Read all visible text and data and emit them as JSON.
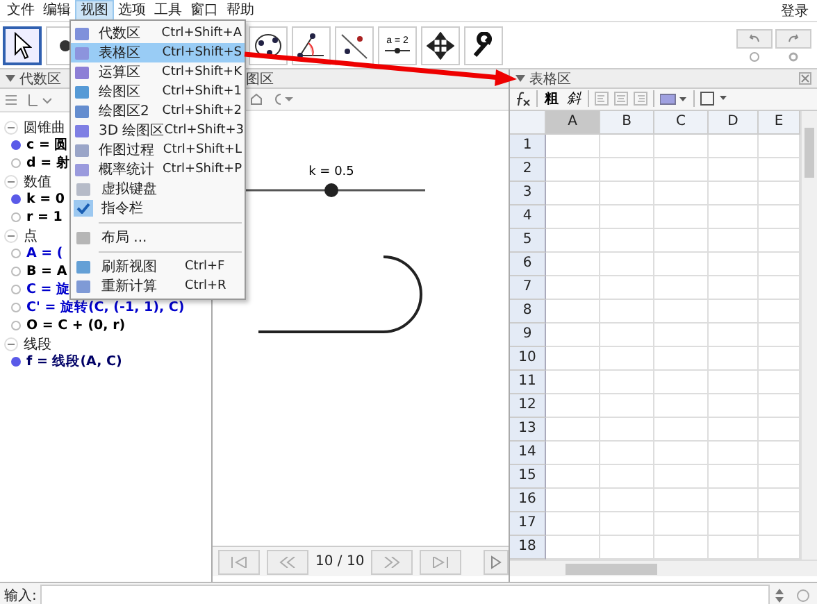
{
  "menu_bar": {
    "items": [
      {
        "label": "文件",
        "selected": false
      },
      {
        "label": "编辑",
        "selected": false
      },
      {
        "label": "视图",
        "selected": true
      },
      {
        "label": "选项",
        "selected": false
      },
      {
        "label": "工具",
        "selected": false
      },
      {
        "label": "窗口",
        "selected": false
      },
      {
        "label": "帮助",
        "selected": false
      }
    ],
    "login": "登录"
  },
  "toolbar": {
    "tools_left": [
      {
        "kind": "select",
        "selected": true
      },
      {
        "kind": "point",
        "selected": false
      }
    ],
    "tools_right": [
      {
        "kind": "circle",
        "selected": false
      },
      {
        "kind": "angle",
        "selected": false
      },
      {
        "kind": "reflect",
        "selected": false
      },
      {
        "kind": "slider",
        "label": "a = 2",
        "selected": false
      },
      {
        "kind": "move",
        "selected": false
      },
      {
        "kind": "wrench",
        "selected": false
      }
    ]
  },
  "view_menu": {
    "items": [
      {
        "kind": "item",
        "label": "代数区",
        "shortcut": "Ctrl+Shift+A",
        "selected": false
      },
      {
        "kind": "item",
        "label": "表格区",
        "shortcut": "Ctrl+Shift+S",
        "selected": true
      },
      {
        "kind": "item",
        "label": "运算区",
        "shortcut": "Ctrl+Shift+K",
        "selected": false
      },
      {
        "kind": "item",
        "label": "绘图区",
        "shortcut": "Ctrl+Shift+1",
        "selected": false
      },
      {
        "kind": "item",
        "label": "绘图区2",
        "shortcut": "Ctrl+Shift+2",
        "selected": false
      },
      {
        "kind": "item",
        "label": "3D 绘图区",
        "shortcut": "Ctrl+Shift+3",
        "selected": false
      },
      {
        "kind": "item",
        "label": "作图过程",
        "shortcut": "Ctrl+Shift+L",
        "selected": false
      },
      {
        "kind": "item",
        "label": "概率统计",
        "shortcut": "Ctrl+Shift+P",
        "selected": false
      },
      {
        "kind": "item",
        "label": "虚拟键盘",
        "selected": false
      },
      {
        "kind": "check",
        "label": "指令栏",
        "checked": true,
        "selected": false
      },
      {
        "kind": "separator"
      },
      {
        "kind": "item",
        "label": "布局 ...",
        "selected": false
      },
      {
        "kind": "separator"
      },
      {
        "kind": "item",
        "label": "刷新视图",
        "shortcut": "Ctrl+F",
        "selected": false
      },
      {
        "kind": "item",
        "label": "重新计算",
        "shortcut": "Ctrl+R",
        "selected": false
      }
    ]
  },
  "algebra": {
    "title": "代数区",
    "groups": [
      {
        "label": "圆锥曲",
        "expanded": true,
        "items": [
          {
            "text": "c = 圆",
            "visible": true,
            "color": "#000000"
          },
          {
            "text": "d = 射",
            "visible": false,
            "color": "#000000"
          }
        ]
      },
      {
        "label": "数值",
        "expanded": true,
        "items": [
          {
            "text": "k = 0",
            "visible": true,
            "color": "#000000"
          },
          {
            "text": "r = 1",
            "visible": false,
            "color": "#000000"
          }
        ]
      },
      {
        "label": "点",
        "expanded": true,
        "items": [
          {
            "text": "A = (",
            "visible": false,
            "color": "#0000cc"
          },
          {
            "text": "B = A",
            "visible": false,
            "color": "#000000"
          },
          {
            "text": "C = 旋",
            "visible": false,
            "color": "#0000cc"
          },
          {
            "text": "C' = 旋转(C, (-1, 1), C)",
            "visible": false,
            "color": "#0000cc"
          },
          {
            "text": "O = C + (0, r)",
            "visible": false,
            "color": "#000000"
          }
        ]
      },
      {
        "label": "线段",
        "expanded": true,
        "items": [
          {
            "text": "f = 线段(A, C)",
            "visible": true,
            "color": "#000066"
          }
        ]
      }
    ]
  },
  "graphics": {
    "title": "图区",
    "slider": {
      "label": "k = 0.5",
      "level": 0.5
    },
    "navigation": {
      "step": "10 / 10"
    }
  },
  "spreadsheet": {
    "title": "表格区",
    "format_buttons": [
      "粗",
      "斜"
    ],
    "columns": [
      {
        "label": "A",
        "selected": true
      },
      {
        "label": "B",
        "selected": false
      },
      {
        "label": "C",
        "selected": false
      },
      {
        "label": "D",
        "selected": false
      },
      {
        "label": "E",
        "selected": false
      }
    ],
    "rows": [
      "1",
      "2",
      "3",
      "4",
      "5",
      "6",
      "7",
      "8",
      "9",
      "10",
      "11",
      "12",
      "13",
      "14",
      "15",
      "16",
      "17",
      "18"
    ]
  },
  "input_bar": {
    "label": "输入:"
  }
}
